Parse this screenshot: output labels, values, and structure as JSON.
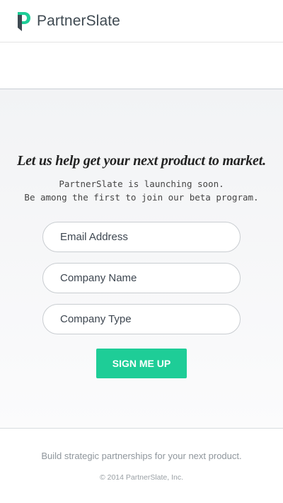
{
  "header": {
    "logo_icon": "partnerslate-logo-mark",
    "brand_name": "PartnerSlate",
    "brand_color": "#1ecd97"
  },
  "hero": {
    "headline": "Let us help get your next product to market.",
    "subline_1": "PartnerSlate is launching soon.",
    "subline_2": "Be among the first to join our beta program.",
    "form": {
      "email_placeholder": "Email Address",
      "company_name_placeholder": "Company Name",
      "company_type_placeholder": "Company Type",
      "submit_label": "SIGN ME UP",
      "submit_color": "#1ecd97"
    }
  },
  "footer": {
    "tagline": "Build strategic partnerships for your next product.",
    "copyright": "© 2014 PartnerSlate, Inc."
  }
}
